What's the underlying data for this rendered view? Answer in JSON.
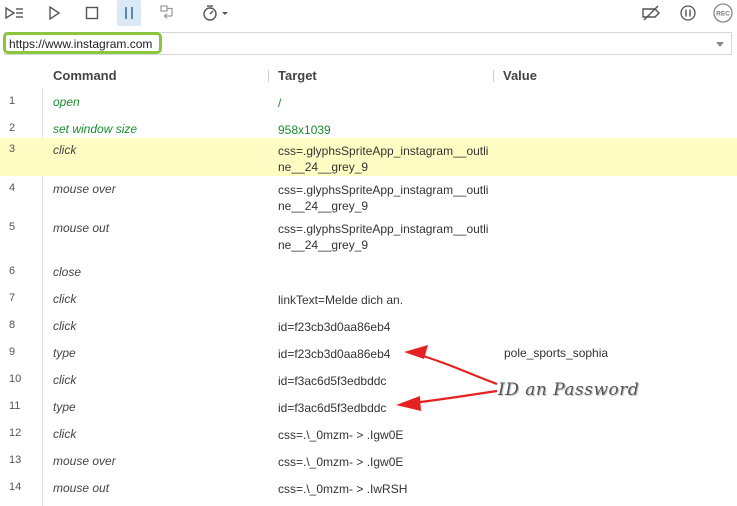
{
  "toolbar": {
    "buttons": [
      {
        "name": "run-all-tests-icon"
      },
      {
        "name": "run-current-test-icon"
      },
      {
        "name": "stop-icon"
      },
      {
        "name": "pause-icon"
      },
      {
        "name": "step-over-icon"
      },
      {
        "name": "test-speed-icon"
      },
      {
        "name": "disable-breakpoints-icon"
      },
      {
        "name": "pause-on-exceptions-icon"
      },
      {
        "name": "record-icon"
      }
    ],
    "record_label": "REC"
  },
  "url": {
    "value": "https://www.instagram.com"
  },
  "table": {
    "headers": {
      "command": "Command",
      "target": "Target",
      "value": "Value"
    },
    "rows": [
      {
        "num": "1",
        "command": "open",
        "target": "/",
        "value": "",
        "status": "ok"
      },
      {
        "num": "2",
        "command": "set window size",
        "target": "958x1039",
        "value": "",
        "status": "ok"
      },
      {
        "num": "3",
        "command": "click",
        "target": "css=.glyphsSpriteApp_instagram__outline__24__grey_9",
        "value": "",
        "status": "selected"
      },
      {
        "num": "4",
        "command": "mouse over",
        "target": "css=.glyphsSpriteApp_instagram__outline__24__grey_9",
        "value": "",
        "status": ""
      },
      {
        "num": "5",
        "command": "mouse out",
        "target": "css=.glyphsSpriteApp_instagram__outline__24__grey_9",
        "value": "",
        "status": ""
      },
      {
        "num": "6",
        "command": "close",
        "target": "",
        "value": "",
        "status": ""
      },
      {
        "num": "7",
        "command": "click",
        "target": "linkText=Melde dich an.",
        "value": "",
        "status": ""
      },
      {
        "num": "8",
        "command": "click",
        "target": "id=f23cb3d0aa86eb4",
        "value": "",
        "status": ""
      },
      {
        "num": "9",
        "command": "type",
        "target": "id=f23cb3d0aa86eb4",
        "value": "pole_sports_sophia",
        "status": ""
      },
      {
        "num": "10",
        "command": "click",
        "target": "id=f3ac6d5f3edbddc",
        "value": "",
        "status": ""
      },
      {
        "num": "11",
        "command": "type",
        "target": "id=f3ac6d5f3edbddc",
        "value": "",
        "status": ""
      },
      {
        "num": "12",
        "command": "click",
        "target": "css=.\\_0mzm- > .Igw0E",
        "value": "",
        "status": ""
      },
      {
        "num": "13",
        "command": "mouse over",
        "target": "css=.\\_0mzm- > .Igw0E",
        "value": "",
        "status": ""
      },
      {
        "num": "14",
        "command": "mouse out",
        "target": "css=.\\_0mzm- > .IwRSH",
        "value": "",
        "status": ""
      }
    ]
  },
  "annotation": {
    "label": "ID an Password",
    "color": "#e52222"
  },
  "colors": {
    "ok_text": "#1a8c2e",
    "selected_row": "#fffdc4",
    "url_highlight": "#8cc63f"
  }
}
